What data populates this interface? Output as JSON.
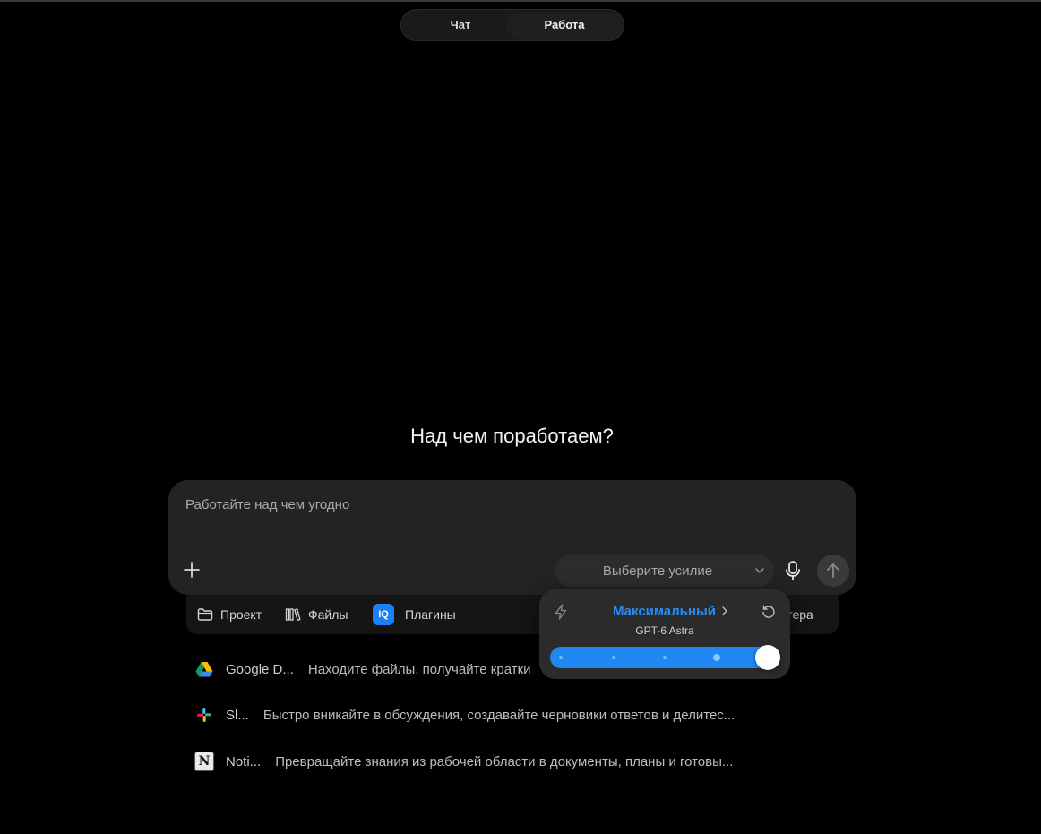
{
  "mode_toggle": {
    "tabs": [
      {
        "label": "Чат",
        "active": false
      },
      {
        "label": "Работа",
        "active": true
      }
    ]
  },
  "headline": "Над чем поработаем?",
  "composer": {
    "placeholder": "Работайте над чем угодно",
    "effort_select_label": "Выберите усилие"
  },
  "tools": {
    "project": "Проект",
    "files": "Файлы",
    "plugins": "Плагины",
    "plugins_badge": "IQ",
    "computer_partial": "ютера"
  },
  "plugins": [
    {
      "name": "Google D...",
      "description": "Находите файлы, получайте кратки",
      "icon": "google-drive-icon"
    },
    {
      "name": "Sl...",
      "description": "Быстро вникайте в обсуждения, создавайте черновики ответов и делитес...",
      "icon": "slack-icon"
    },
    {
      "name": "Noti...",
      "description": "Превращайте знания из рабочей области в документы, планы и готовы...",
      "icon": "notion-icon",
      "glyph": "N"
    }
  ],
  "effort_popup": {
    "level": "Максимальный",
    "model": "GPT-6 Astra",
    "slider_value": 1.0
  },
  "colors": {
    "accent": "#2a8cf3",
    "slider": "#1e88f0",
    "background": "#000000",
    "composer": "#232323"
  }
}
